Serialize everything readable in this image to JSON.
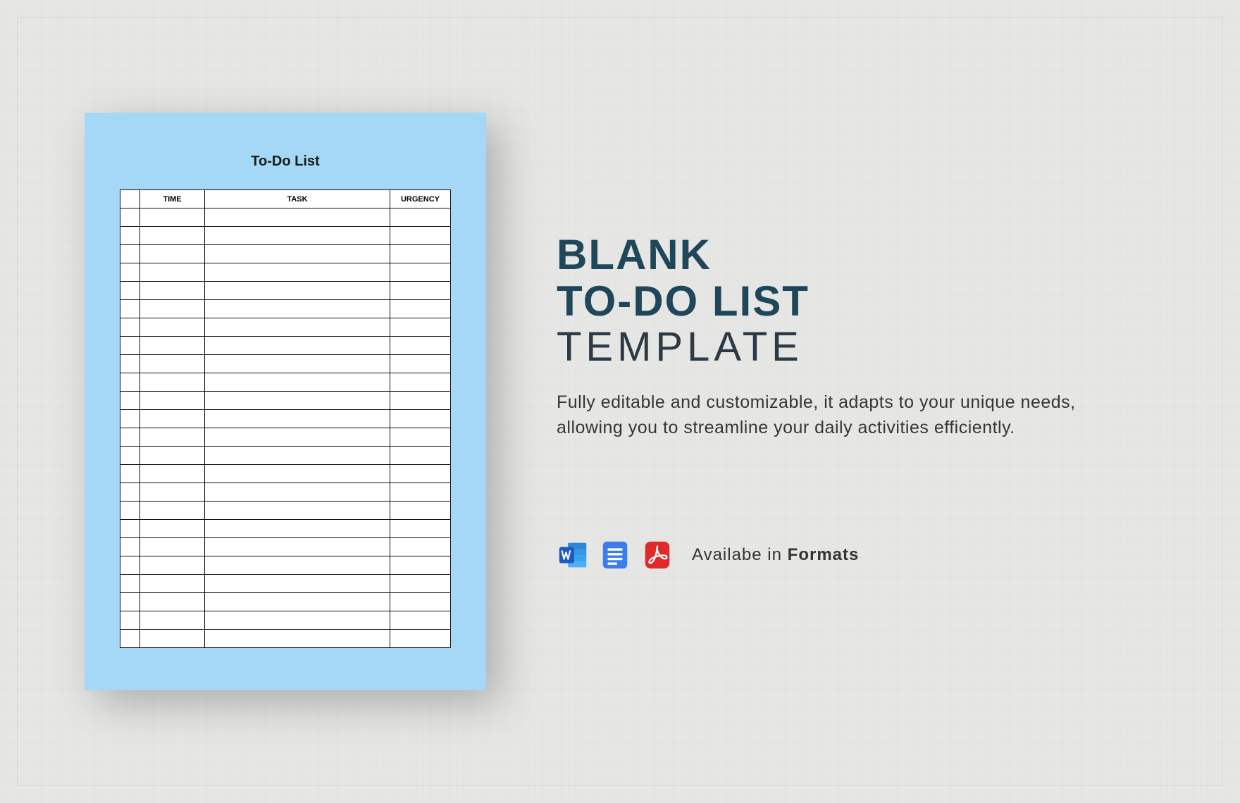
{
  "preview": {
    "title": "To-Do List",
    "columns": {
      "check": "",
      "time": "TIME",
      "task": "TASK",
      "urgency": "URGENCY"
    },
    "row_count": 24
  },
  "heading": {
    "line1": "BLANK",
    "line2": "TO-DO LIST",
    "line3": "TEMPLATE"
  },
  "description": "Fully editable and customizable, it adapts to your unique needs, allowing you to streamline your daily activities efficiently.",
  "formats": {
    "label_prefix": "Availabe in ",
    "label_bold": "Formats",
    "apps": [
      {
        "name": "word-icon",
        "title": "Word"
      },
      {
        "name": "google-docs-icon",
        "title": "Google Docs"
      },
      {
        "name": "pdf-icon",
        "title": "PDF"
      }
    ]
  }
}
